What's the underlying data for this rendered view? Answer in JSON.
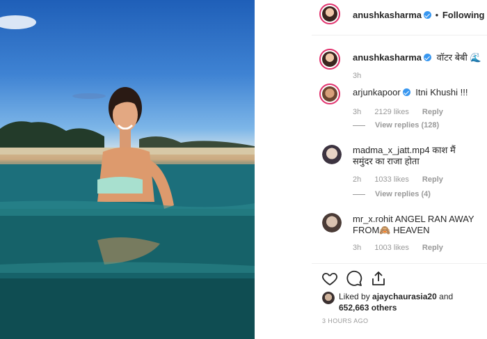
{
  "header": {
    "username": "anushkasharma",
    "separator": "•",
    "follow_label": "Following"
  },
  "caption": {
    "username": "anushkasharma",
    "text": "वॉटर बेबी 🌊",
    "time": "3h"
  },
  "comments": [
    {
      "username": "arjunkapoor",
      "verified": true,
      "text": "Itni Khushi !!!",
      "time": "3h",
      "likes": "2129 likes",
      "reply_label": "Reply",
      "view_replies": "View replies (128)"
    },
    {
      "username": "madma_x_jatt.mp4",
      "verified": false,
      "text": "काश मैं समुंदर का राजा होता",
      "time": "2h",
      "likes": "1033 likes",
      "reply_label": "Reply",
      "view_replies": "View replies (4)"
    },
    {
      "username": "mr_x.rohit",
      "verified": false,
      "text": "ANGEL RAN AWAY FROM🙈 HEAVEN",
      "time": "3h",
      "likes": "1003 likes",
      "reply_label": "Reply"
    }
  ],
  "actions": {
    "like_icon": "heart-icon",
    "comment_icon": "comment-icon",
    "share_icon": "share-icon"
  },
  "likes": {
    "prefix": "Liked by",
    "user": "ajaychaurasia20",
    "middle": "and",
    "count": "652,663 others"
  },
  "timestamp": "3 HOURS AGO",
  "colors": {
    "verified": "#3897f0",
    "story_ring": "#e1306c",
    "muted": "#999999"
  }
}
